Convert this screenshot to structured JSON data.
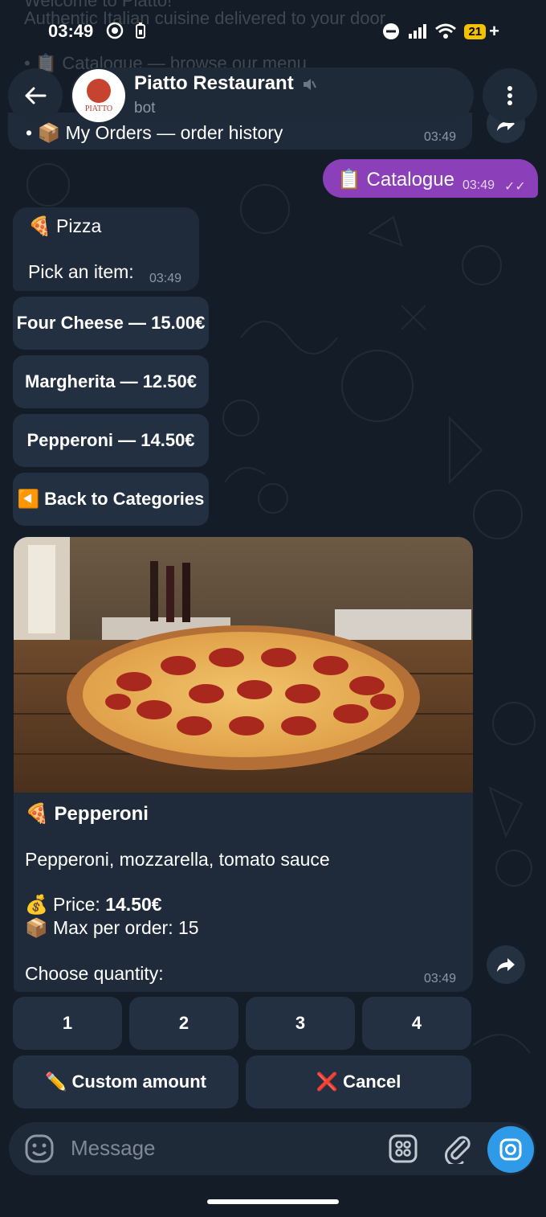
{
  "status": {
    "time": "03:49",
    "battery": "21"
  },
  "ghost_lines": [
    "Welcome to Piatto!",
    "Authentic Italian cuisine delivered to your door",
    "• 📋 Catalogue — browse our menu"
  ],
  "header": {
    "title": "Piatto Restaurant",
    "subtitle": "bot",
    "avatar_text": "PIATTO"
  },
  "prev_message": {
    "text": "• 📦 My Orders — order history",
    "time": "03:49"
  },
  "outgoing": {
    "text": "📋 Catalogue",
    "time": "03:49"
  },
  "pizza_message": {
    "line1": "🍕 Pizza",
    "line2": "Pick an item:",
    "time": "03:49"
  },
  "item_buttons": [
    "Four Cheese — 15.00€",
    "Margherita — 12.50€",
    "Pepperoni — 14.50€",
    "◀️ Back to Categories"
  ],
  "product": {
    "title": "🍕 Pepperoni",
    "description": "Pepperoni, mozzarella, tomato sauce",
    "price_label": "💰 Price: ",
    "price_value": "14.50€",
    "max_label": "📦 Max per order: 15",
    "choose": "Choose quantity:",
    "time": "03:49"
  },
  "quantity_buttons": [
    "1",
    "2",
    "3",
    "4"
  ],
  "action_buttons": {
    "custom": "✏️ Custom amount",
    "cancel": "❌ Cancel"
  },
  "input": {
    "placeholder": "Message"
  }
}
